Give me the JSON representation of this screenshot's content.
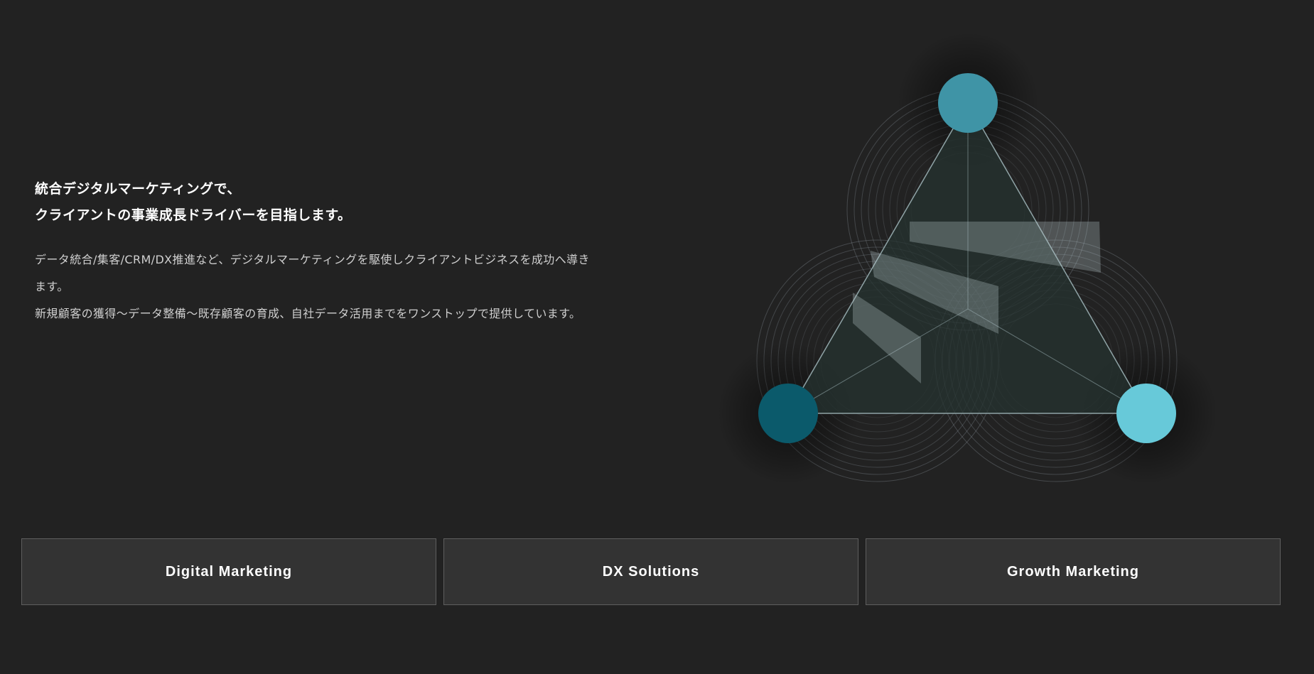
{
  "intro": {
    "headline_line1": "統合デジタルマーケティングで、",
    "headline_line2": "クライアントの事業成長ドライバーを目指します。",
    "paragraph1": "データ統合/集客/CRM/DX推進など、デジタルマーケティングを駆使しクライアントビジネスを成功へ導きます。",
    "paragraph2": "新規顧客の獲得〜データ整備〜既存顧客の育成、自社データ活用までをワンストップで提供しています。"
  },
  "graphic": {
    "node_colors": {
      "top": "#3f94a6",
      "left": "#0b5a6b",
      "right": "#67c9d9"
    },
    "triangle_fill": "#263330",
    "line_color": "#8fa3a6"
  },
  "cards": [
    {
      "label": "Digital Marketing"
    },
    {
      "label": "DX Solutions"
    },
    {
      "label": "Growth Marketing"
    }
  ]
}
